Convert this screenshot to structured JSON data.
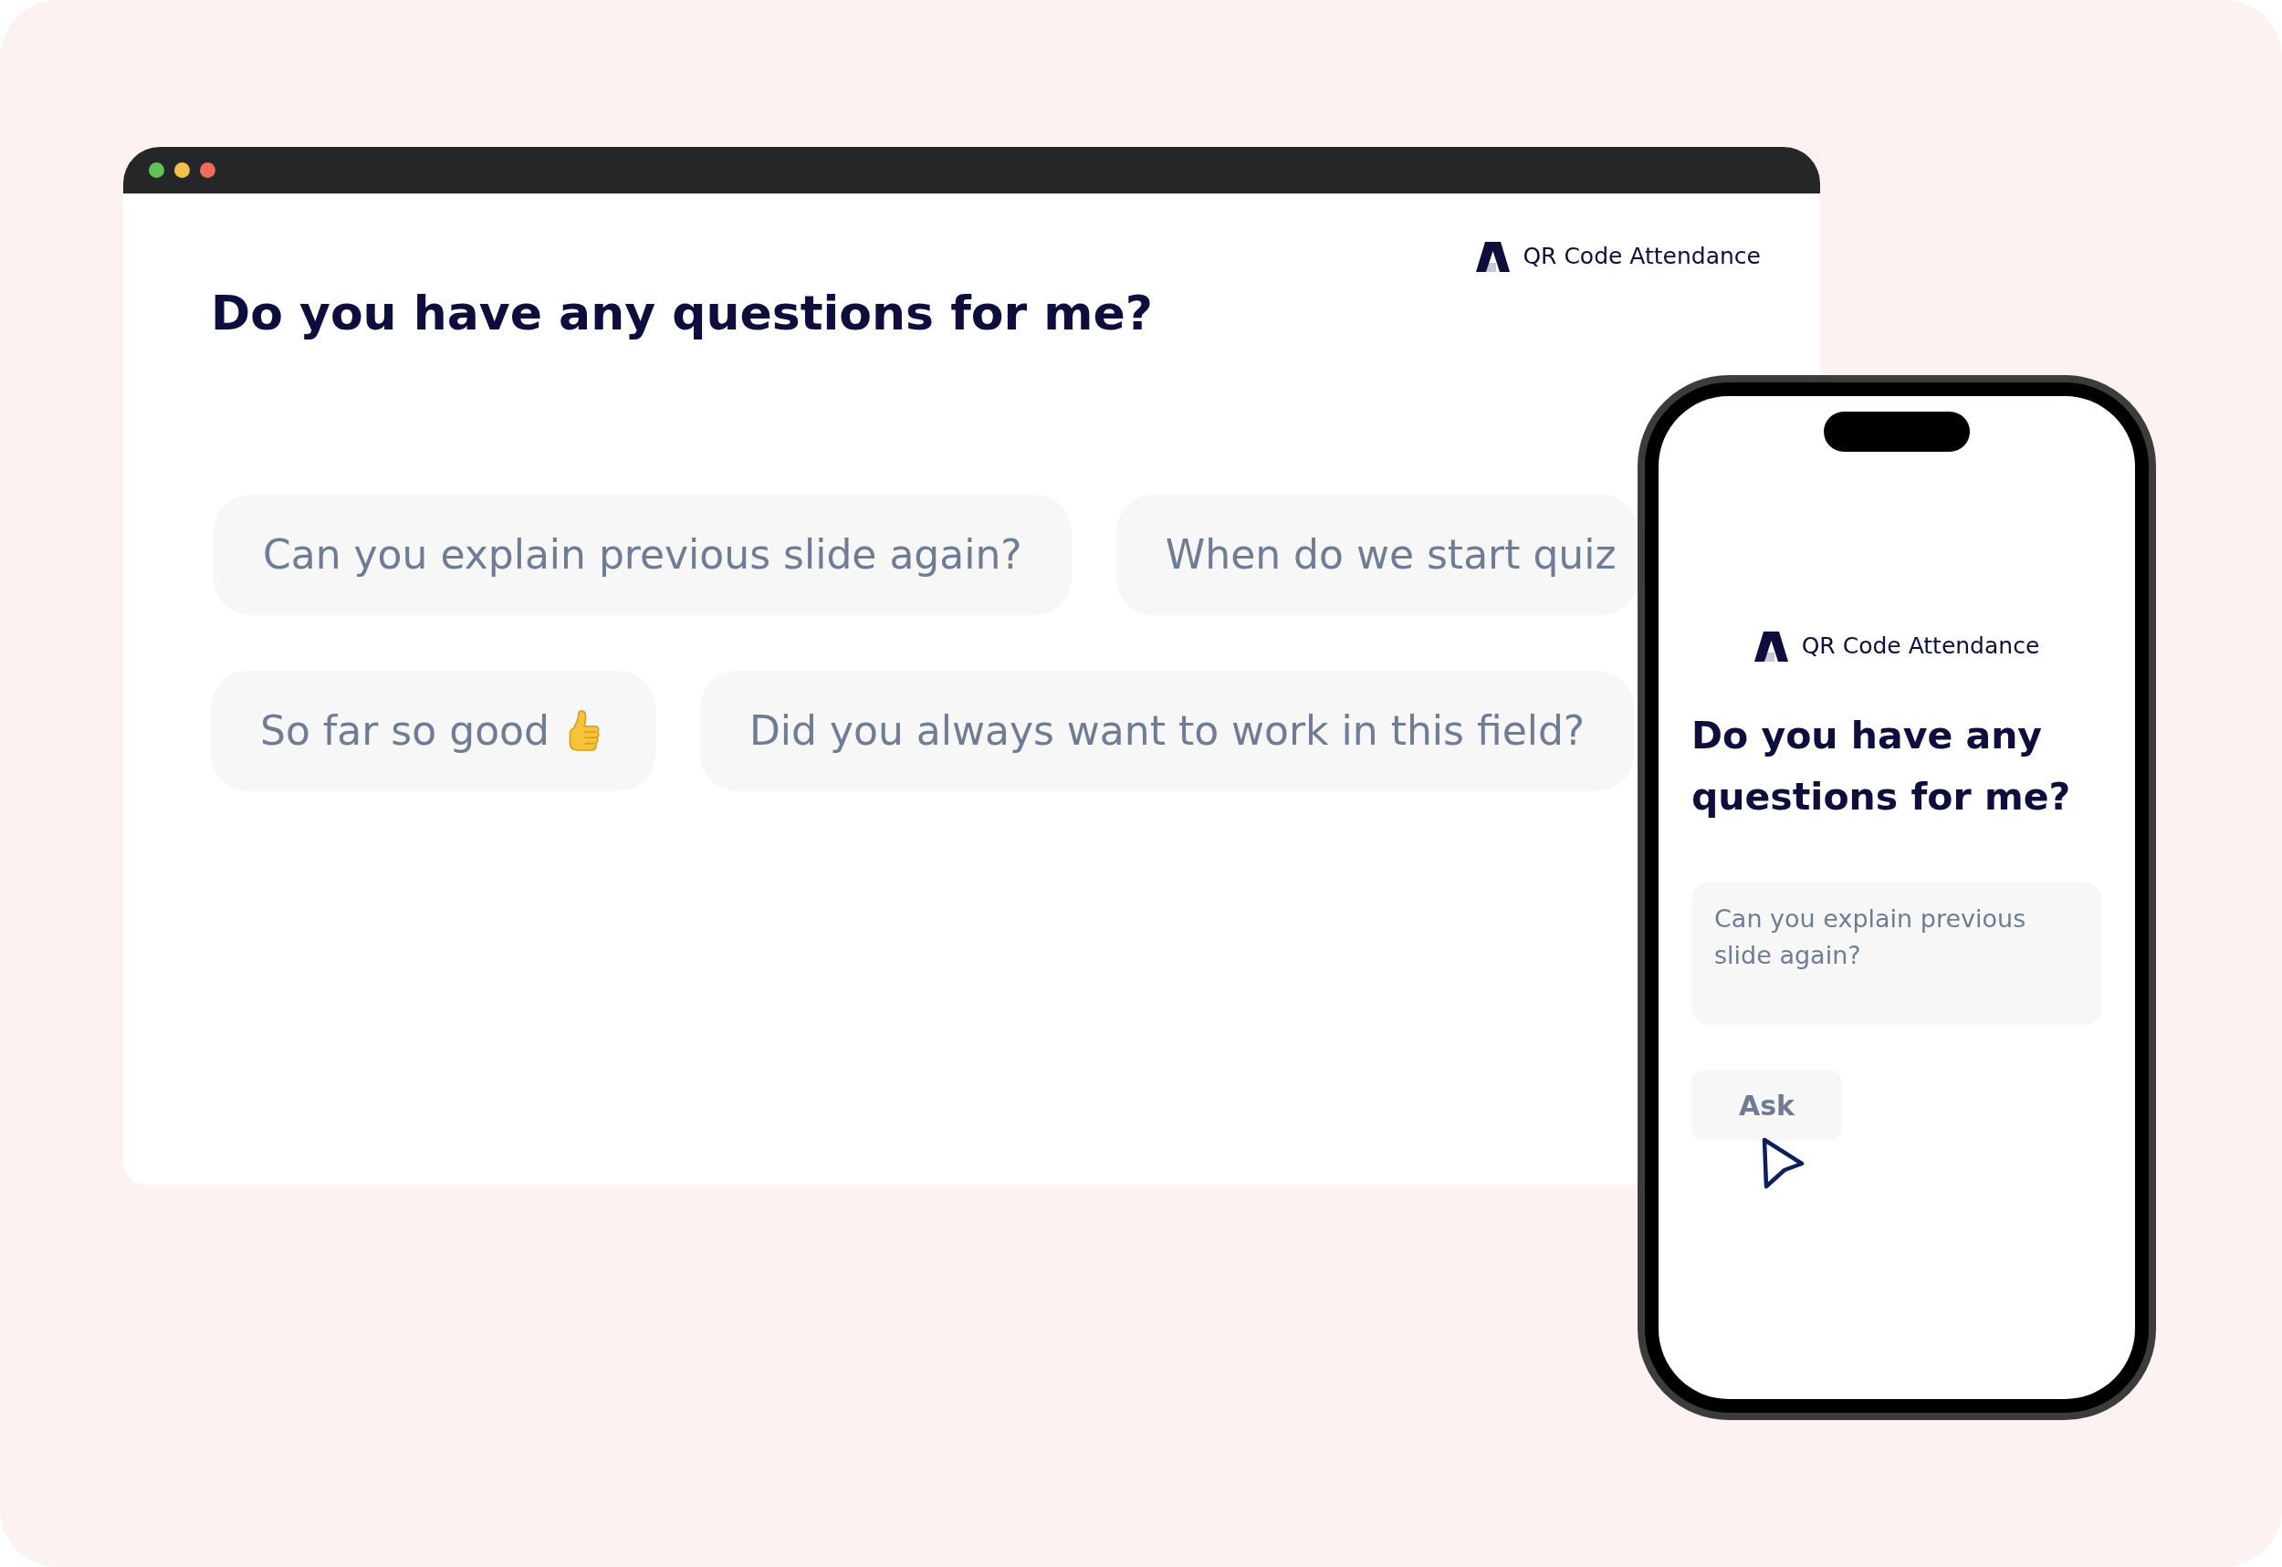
{
  "browser_window": {
    "window_controls": [
      {
        "color": "#5fc454"
      },
      {
        "color": "#f5c14e"
      },
      {
        "color": "#ee6b60"
      }
    ],
    "brand": {
      "name": "QR Code Attendance"
    },
    "heading": "Do you have any questions for me?",
    "question_rows": [
      {
        "questions": [
          {
            "kind": "text",
            "text": "Can you explain previous slide again?"
          },
          {
            "kind": "text",
            "text": "When do we start quiz"
          }
        ]
      },
      {
        "questions": [
          {
            "kind": "emoji",
            "text": "So far so good"
          },
          {
            "kind": "text",
            "text": "Did you always want to work in this field?"
          }
        ]
      }
    ]
  },
  "phone": {
    "brand": {
      "name": "QR Code Attendance"
    },
    "heading": "Do you have any questions for me?",
    "question_field": {
      "value": "Can you explain previous slide again?"
    },
    "ask_button": {
      "label": "Ask"
    }
  }
}
